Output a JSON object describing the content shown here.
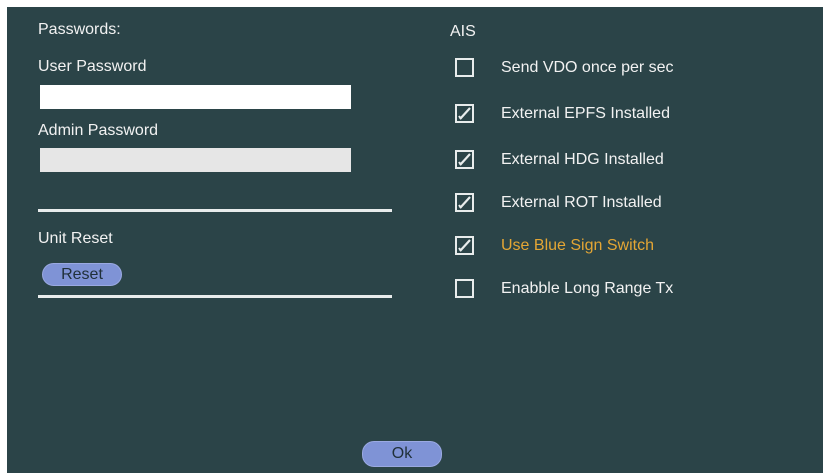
{
  "passwords": {
    "heading": "Passwords:",
    "user_password_label": "User Password",
    "user_password_value": "",
    "admin_password_label": "Admin Password",
    "admin_password_value": ""
  },
  "unit_reset": {
    "heading": "Unit Reset",
    "button_label": "Reset"
  },
  "ais": {
    "heading": "AIS",
    "options": [
      {
        "label": "Send VDO once per sec",
        "checked": false,
        "highlight": false
      },
      {
        "label": "External EPFS Installed",
        "checked": true,
        "highlight": false
      },
      {
        "label": "External HDG Installed",
        "checked": true,
        "highlight": false
      },
      {
        "label": "External ROT Installed",
        "checked": true,
        "highlight": false
      },
      {
        "label": "Use Blue Sign Switch",
        "checked": true,
        "highlight": true
      },
      {
        "label": "Enabble Long Range Tx",
        "checked": false,
        "highlight": false
      }
    ]
  },
  "footer": {
    "ok_label": "Ok"
  },
  "colors": {
    "background": "#2b4448",
    "text": "#f2f2f2",
    "highlight": "#e4a634",
    "button": "#7f93d6"
  }
}
